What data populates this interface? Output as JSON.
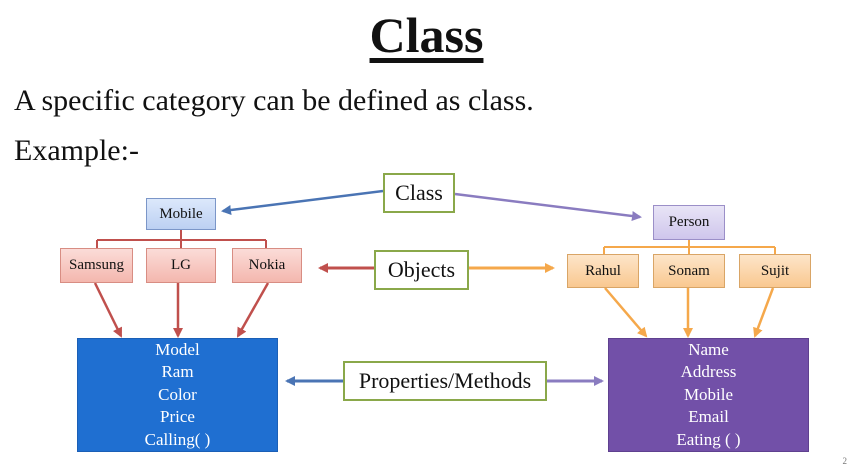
{
  "title": "Class",
  "definition": "A specific category can be defined as class.",
  "example_label": "Example:-",
  "labels": {
    "class": "Class",
    "objects": "Objects",
    "properties": "Properties/Methods"
  },
  "left": {
    "class_name": "Mobile",
    "objects": [
      "Samsung",
      "LG",
      "Nokia"
    ],
    "properties": [
      "Model",
      "Ram",
      "Color",
      "Price",
      "Calling( )"
    ]
  },
  "right": {
    "class_name": "Person",
    "objects": [
      "Rahul",
      "Sonam",
      "Sujit"
    ],
    "properties": [
      "Name",
      "Address",
      "Mobile",
      "Email",
      "Eating ( )"
    ]
  },
  "page_number": "2",
  "colors": {
    "blue_arrow": "#4a74b4",
    "purple_arrow": "#8a7cc0",
    "red_arrow": "#c0504d",
    "orange_arrow": "#f5a84b",
    "blue_box": "#1f6fd1",
    "purple_box": "#7250a8",
    "label_border": "#8aa84a"
  }
}
